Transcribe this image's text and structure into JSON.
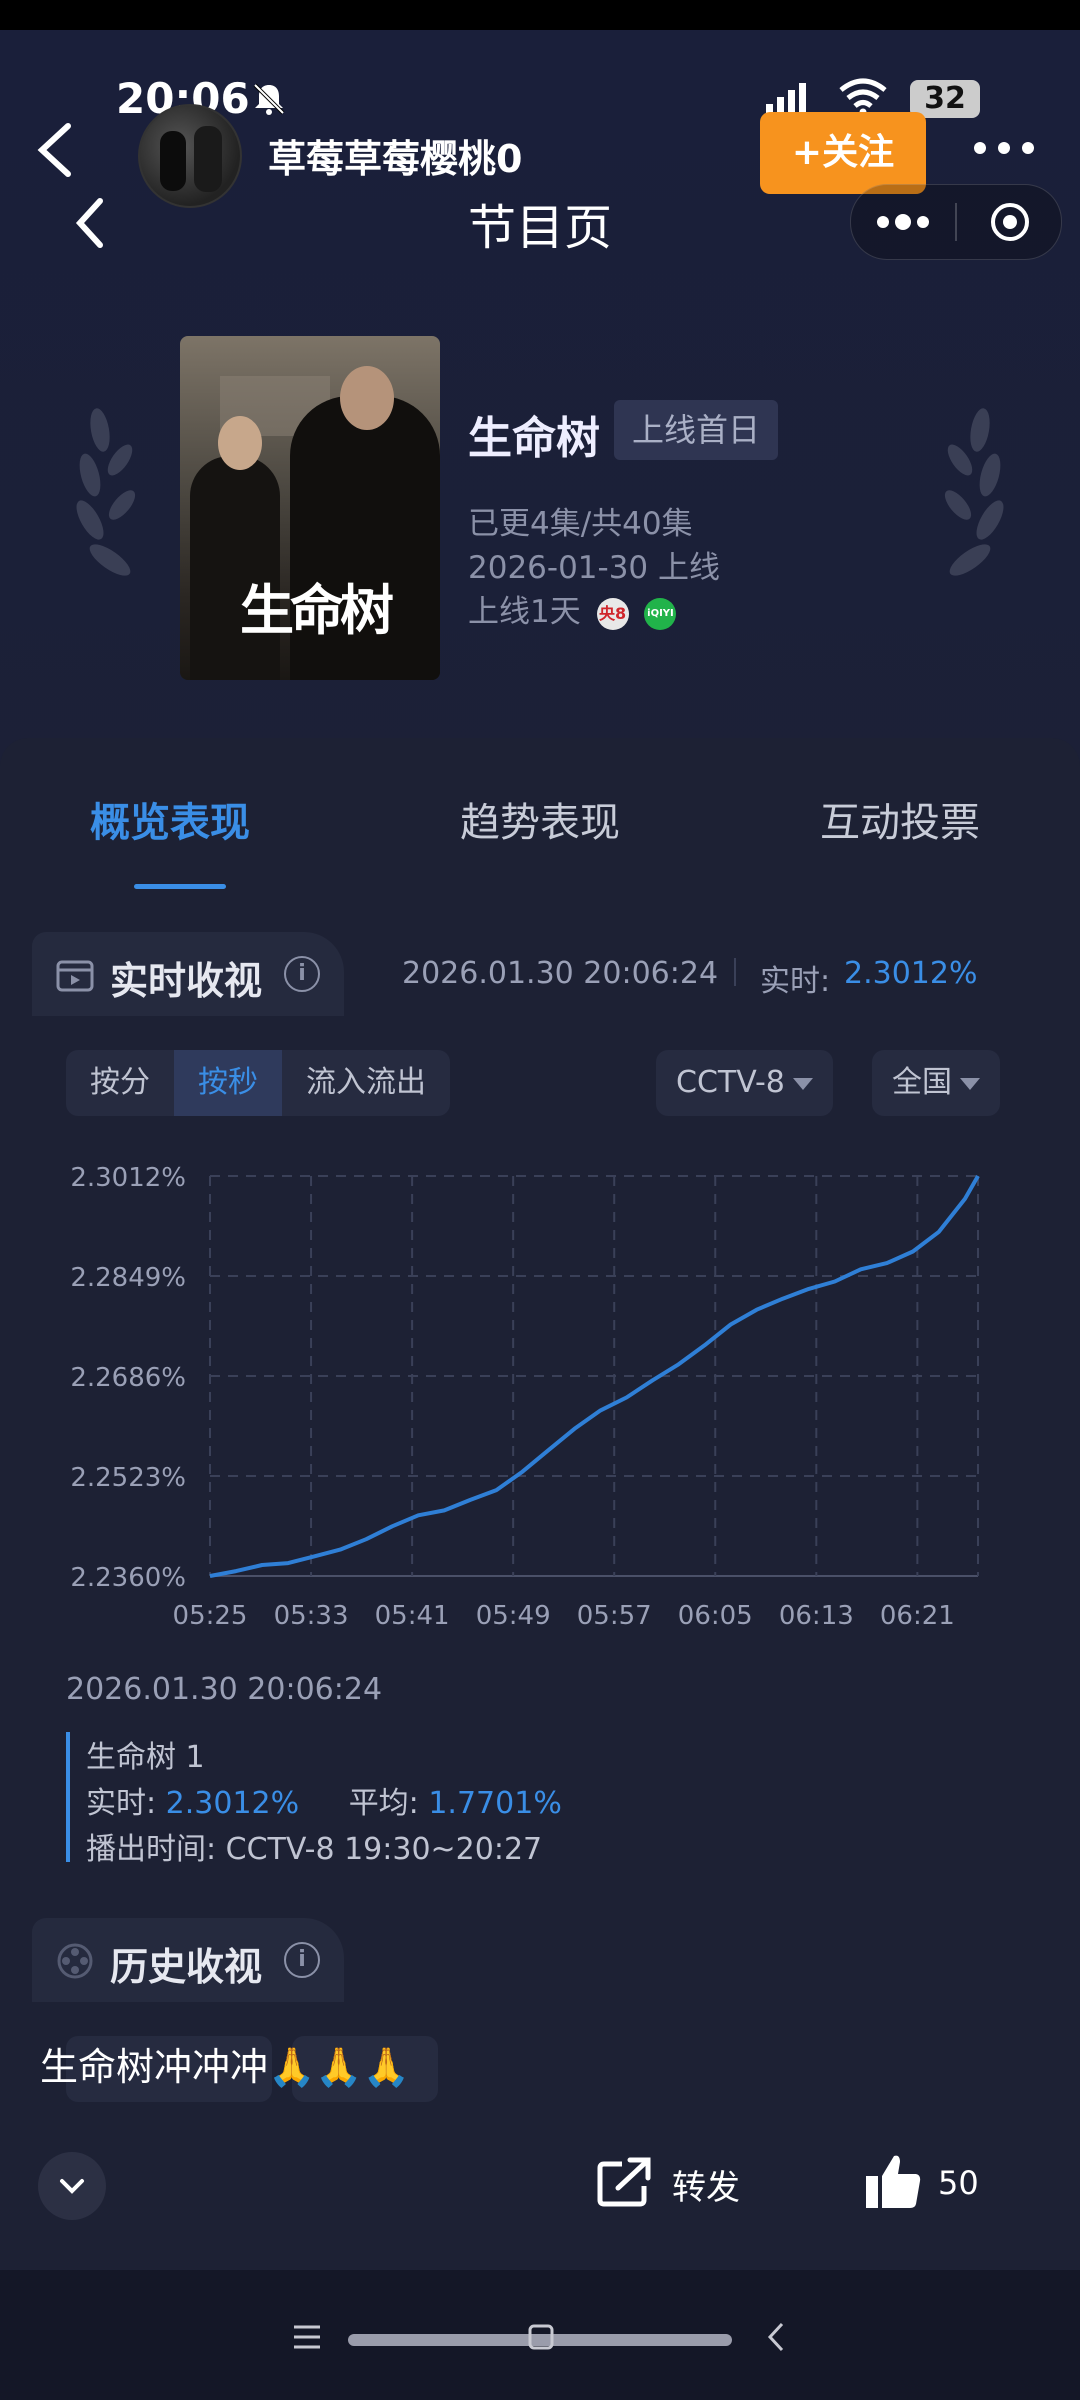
{
  "status_bar": {
    "time": "20:06",
    "battery": "32"
  },
  "overlay": {
    "username": "草莓草莓樱桃0",
    "follow_label": "+关注"
  },
  "mini_program": {
    "title": "节目页"
  },
  "program": {
    "poster_title": "生命树",
    "name": "生命树",
    "tag": "上线首日",
    "episodes": "已更4集/共40集",
    "release": "2026-01-30 上线",
    "days_online": "上线1天",
    "channel_badge_1": "央8",
    "channel_badge_2": "iQIYI"
  },
  "tabs": [
    {
      "label": "概览表现"
    },
    {
      "label": "趋势表现"
    },
    {
      "label": "互动投票"
    }
  ],
  "realtime": {
    "title": "实时收视",
    "timestamp": "2026.01.30 20:06:24",
    "value_label": "实时:",
    "value": "2.3012%",
    "segments": [
      "按分",
      "按秒",
      "流入流出"
    ],
    "channel_select": "CCTV-8",
    "region_select": "全国"
  },
  "chart_data": {
    "type": "line",
    "ylabels": [
      "2.3012%",
      "2.2849%",
      "2.2686%",
      "2.2523%",
      "2.2360%"
    ],
    "xlabels": [
      "05:25",
      "05:33",
      "05:41",
      "05:49",
      "05:57",
      "06:05",
      "06:13",
      "06:21"
    ],
    "ylim": [
      2.236,
      2.3012
    ],
    "xlim": [
      0,
      59
    ],
    "series": [
      {
        "color": "#2f7fd6",
        "x": [
          0,
          2,
          4,
          6,
          8,
          10,
          12,
          14,
          16,
          18,
          20,
          22,
          24,
          26,
          28,
          30,
          32,
          34,
          36,
          38,
          40,
          42,
          44,
          46,
          48,
          50,
          52,
          54,
          56,
          58,
          59
        ],
        "y": [
          2.236,
          2.2368,
          2.2378,
          2.2381,
          2.2392,
          2.2403,
          2.242,
          2.2441,
          2.2459,
          2.2467,
          2.2484,
          2.25,
          2.253,
          2.2565,
          2.26,
          2.263,
          2.2651,
          2.2679,
          2.2705,
          2.2736,
          2.277,
          2.2794,
          2.2812,
          2.2828,
          2.284,
          2.286,
          2.287,
          2.2889,
          2.2921,
          2.2975,
          2.3012
        ]
      }
    ]
  },
  "detail": {
    "timestamp": "2026.01.30 20:06:24",
    "program": "生命树 1",
    "realtime_label": "实时:",
    "realtime_value": "2.3012%",
    "avg_label": "平均:",
    "avg_value": "1.7701%",
    "airtime": "播出时间: CCTV-8 19:30~20:27"
  },
  "history": {
    "title": "历史收视"
  },
  "comment": {
    "text": "生命树冲冲冲🙏🙏🙏"
  },
  "bottom": {
    "share_label": "转发",
    "likes": "50"
  }
}
